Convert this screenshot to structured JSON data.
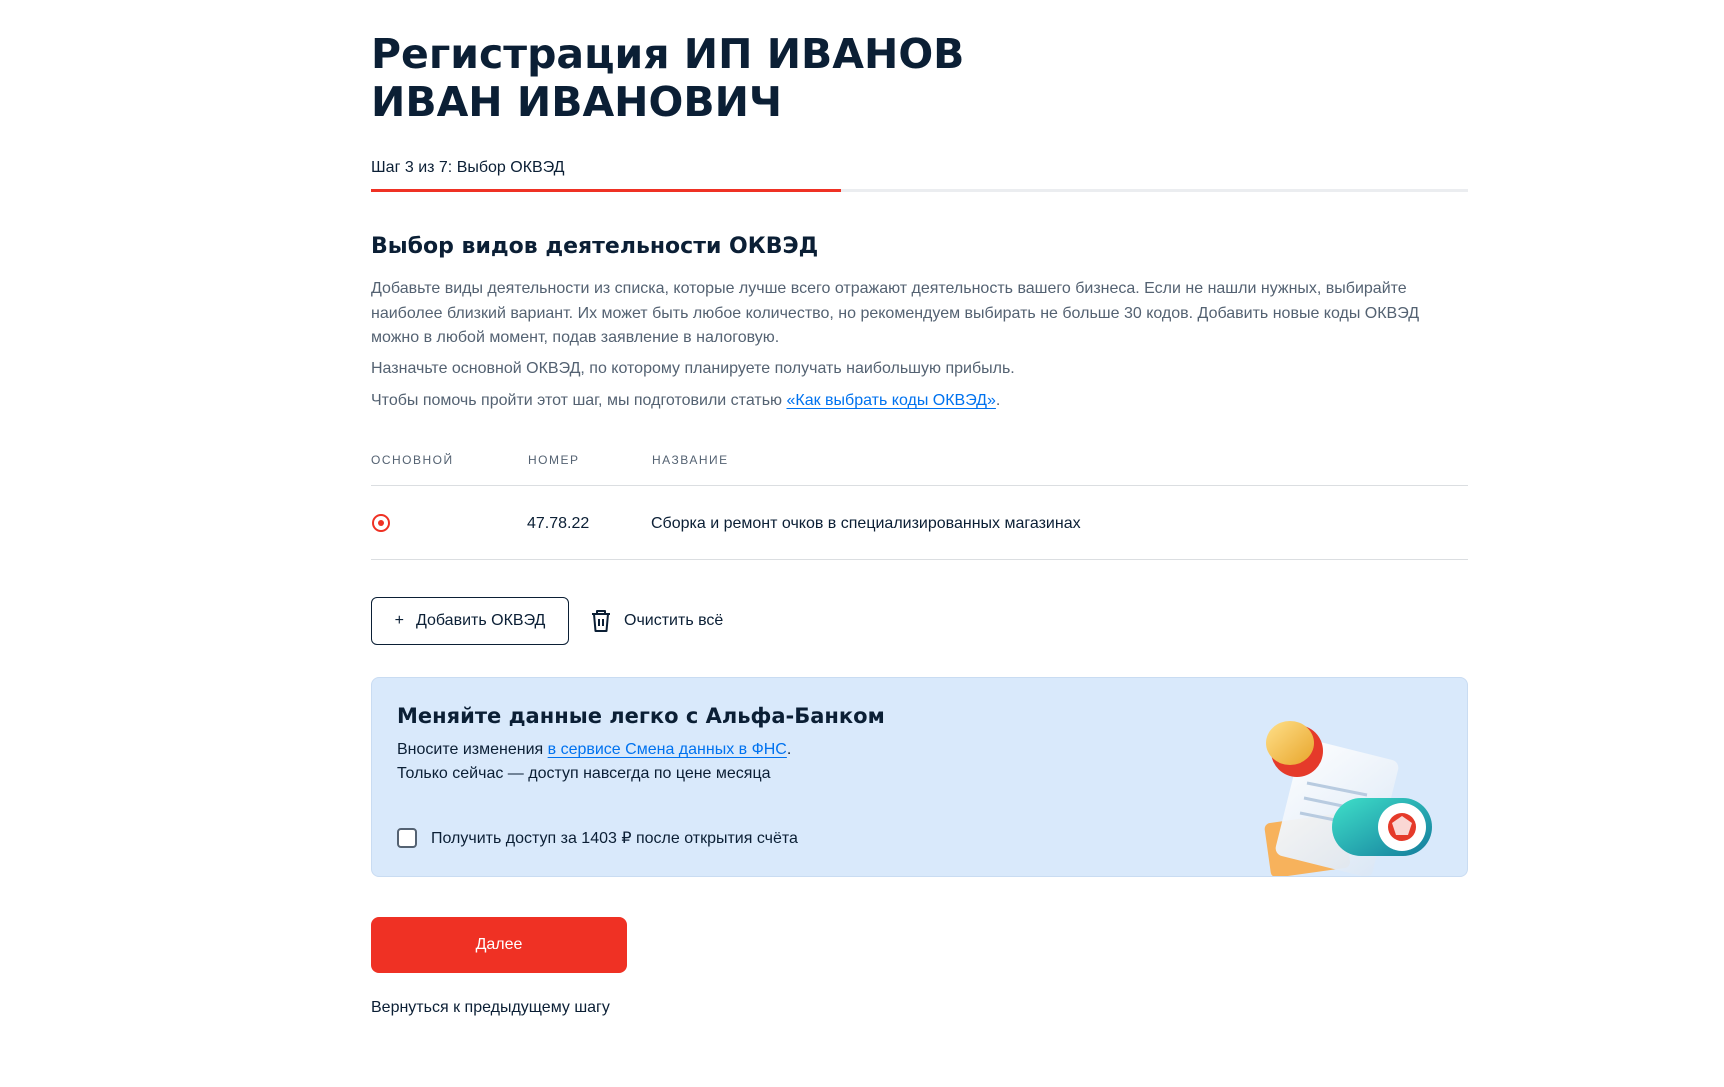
{
  "page": {
    "title": "Регистрация ИП ИВАНОВ ИВАН ИВАНОВИЧ",
    "step_label": "Шаг 3 из 7: Выбор ОКВЭД",
    "step_current": 3,
    "step_total": 7
  },
  "section": {
    "title": "Выбор видов деятельности ОКВЭД",
    "paragraph1": "Добавьте виды деятельности из списка, которые лучше всего отражают деятельность вашего бизнеса. Если не нашли нужных, выбирайте наиболее близкий вариант. Их может быть любое количество, но рекомендуем выбирать не больше 30 кодов. Добавить новые коды ОКВЭД можно в любой момент, подав заявление в налоговую.",
    "paragraph2": "Назначьте основной ОКВЭД, по которому планируете получать наибольшую прибыль.",
    "paragraph3_prefix": "Чтобы помочь пройти этот шаг, мы подготовили статью ",
    "paragraph3_link": "«Как выбрать коды ОКВЭД»",
    "paragraph3_suffix": "."
  },
  "table": {
    "headers": {
      "main": "Основной",
      "number": "Номер",
      "name": "Название"
    },
    "rows": [
      {
        "main": true,
        "number": "47.78.22",
        "name": "Сборка и ремонт очков в специализированных магазинах"
      }
    ]
  },
  "actions": {
    "add_label": "Добавить ОКВЭД",
    "add_icon": "plus-icon",
    "clear_label": "Очистить всё",
    "clear_icon": "trash-icon"
  },
  "promo": {
    "title": "Меняйте данные легко с Альфа-Банком",
    "line1_prefix": "Вносите изменения ",
    "line1_link": "в сервисе Смена данных в ФНС",
    "line1_suffix": ".",
    "line2": "Только сейчас — доступ навсегда по цене месяца",
    "checkbox_label": "Получить доступ за 1403 ₽ после открытия счёта",
    "checkbox_checked": false
  },
  "footer": {
    "next_label": "Далее",
    "back_label": "Вернуться к предыдущему шагу"
  },
  "colors": {
    "accent": "#ef3124",
    "text": "#0b1f35",
    "secondary_text": "#546272",
    "link": "#0072ef",
    "promo_bg": "#d9e9fb"
  }
}
